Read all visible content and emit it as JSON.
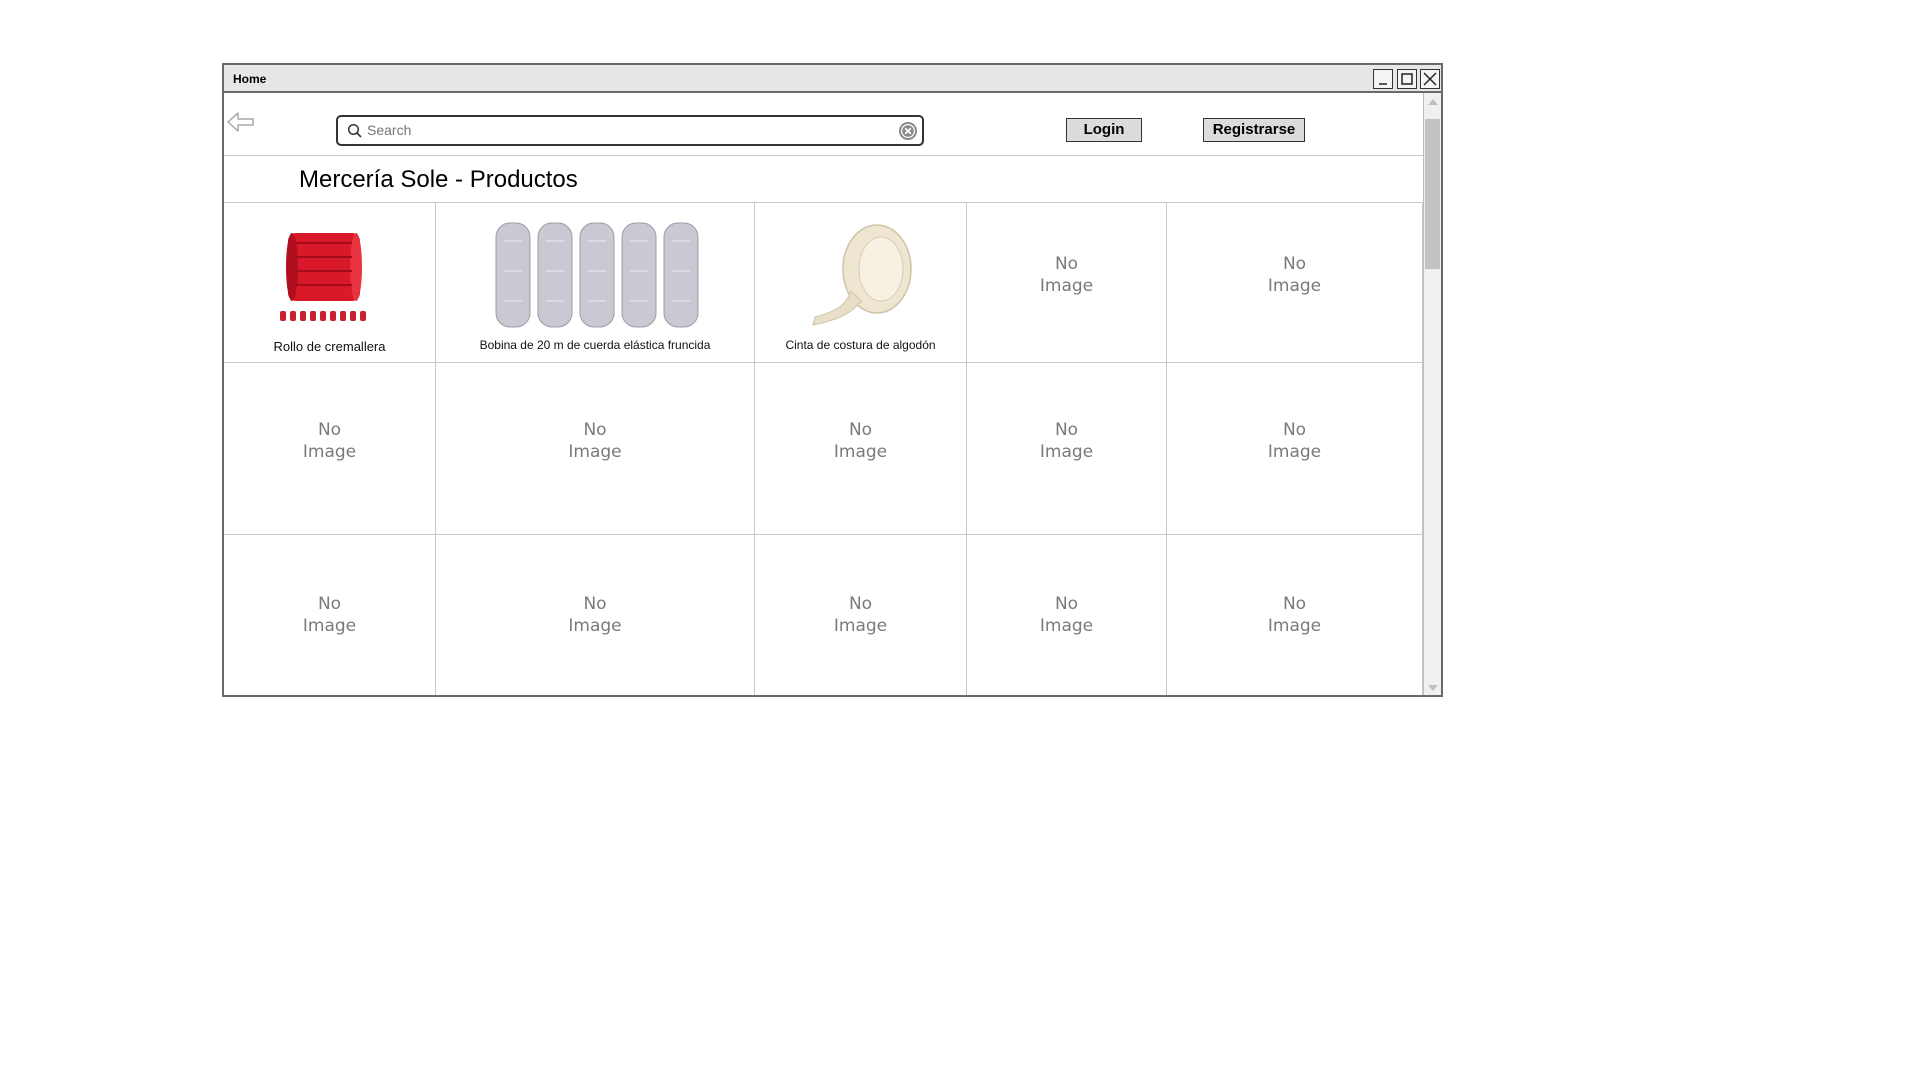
{
  "window": {
    "title": "Home"
  },
  "toolbar": {
    "search_placeholder": "Search",
    "login_label": "Login",
    "register_label": "Registrarse"
  },
  "page": {
    "title": "Mercería Sole - Productos"
  },
  "products": [
    {
      "caption": "Rollo de cremallera",
      "image": "red-zipper-roll"
    },
    {
      "caption": "Bobina de 20 m de cuerda elástica fruncida",
      "image": "grey-elastic-bobbins"
    },
    {
      "caption": "Cinta de costura de algodón",
      "image": "cotton-tape-roll"
    }
  ],
  "placeholder": {
    "line1": "No",
    "line2": "Image"
  },
  "colors": {
    "zipper_red": "#d7192a",
    "bobbin_grey": "#c9c9d3",
    "tape_cream": "#efe6d2"
  }
}
